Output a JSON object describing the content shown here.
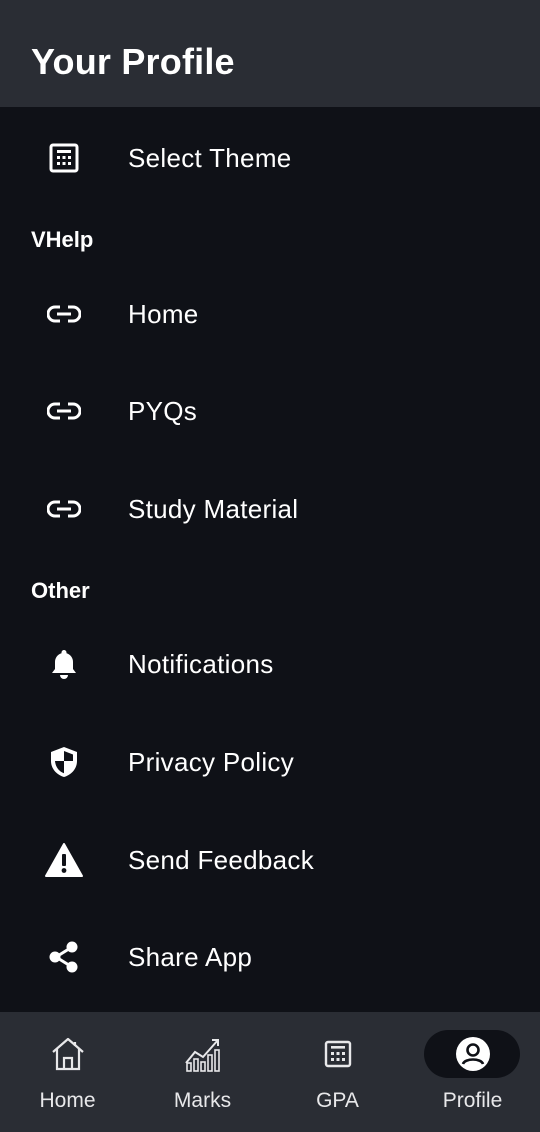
{
  "header": {
    "title": "Your Profile"
  },
  "items": {
    "select_theme": "Select Theme",
    "home": "Home",
    "pyqs": "PYQs",
    "study_material": "Study Material",
    "notifications": "Notifications",
    "privacy_policy": "Privacy Policy",
    "send_feedback": "Send Feedback",
    "share_app": "Share App"
  },
  "sections": {
    "vhelp": "VHelp",
    "other": "Other"
  },
  "nav": {
    "home": "Home",
    "marks": "Marks",
    "gpa": "GPA",
    "profile": "Profile",
    "active": "Profile"
  },
  "colors": {
    "background": "#0f1117",
    "header": "#2a2d34",
    "text": "#ffffff"
  },
  "icons": {
    "select_theme": "calculator-grid-icon",
    "links": "link-icon",
    "notifications": "bell-icon",
    "privacy_policy": "shield-icon",
    "send_feedback": "warning-icon",
    "share_app": "share-icon",
    "nav_home": "home-icon",
    "nav_marks": "chart-icon",
    "nav_gpa": "calculator-icon",
    "nav_profile": "account-circle-icon"
  }
}
